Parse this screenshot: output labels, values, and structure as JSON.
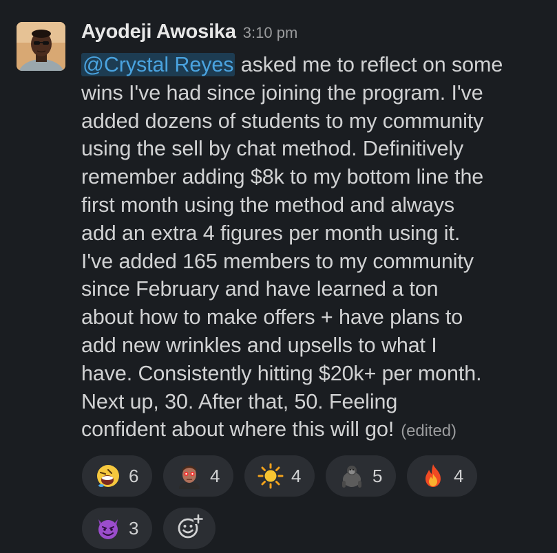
{
  "message": {
    "author": "Ayodeji Awosika",
    "timestamp": "3:10 pm",
    "mention": "@Crystal Reyes",
    "lines": [
      " asked me to reflect on some",
      "wins I've had since joining the program. I've",
      "added dozens of students to my community",
      "using the sell by chat method. Definitively",
      "remember adding $8k to my bottom line the",
      "first month using the method and always",
      "add an extra 4 figures per month using it.",
      "I've added 165 members to my community",
      "since February and have learned a ton",
      "about how to make offers + have plans to",
      "add new wrinkles and upsells to what I",
      "have. Consistently hitting $20k+ per month.",
      "Next up, 30. After that, 50. Feeling",
      "confident about where this will go!"
    ],
    "edited_label": "(edited)"
  },
  "reactions": [
    {
      "icon": "laughing-face-icon",
      "count": "6"
    },
    {
      "icon": "laser-eyes-man-icon",
      "count": "4"
    },
    {
      "icon": "sun-icon",
      "count": "4"
    },
    {
      "icon": "gorilla-icon",
      "count": "5"
    },
    {
      "icon": "fire-icon",
      "count": "4"
    },
    {
      "icon": "smiling-imp-icon",
      "count": "3"
    }
  ],
  "add_reaction": {
    "icon": "add-reaction-icon"
  },
  "colors": {
    "background": "#1a1d21",
    "text": "#d1d2d3",
    "mention_text": "#4aa3df",
    "mention_bg": "#1d3c52",
    "pill_bg": "#2b2e33",
    "muted": "#9a9b9d"
  }
}
